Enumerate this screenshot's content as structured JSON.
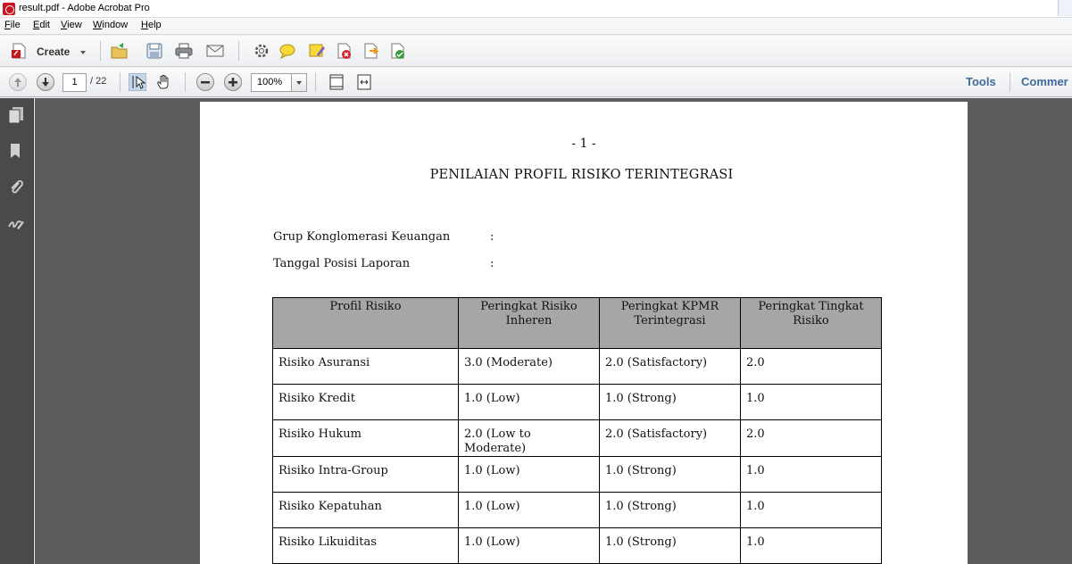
{
  "window": {
    "title": "result.pdf - Adobe Acrobat Pro"
  },
  "menu": {
    "items": [
      {
        "pre": "",
        "u": "F",
        "post": "ile"
      },
      {
        "pre": "",
        "u": "E",
        "post": "dit"
      },
      {
        "pre": "",
        "u": "V",
        "post": "iew"
      },
      {
        "pre": "",
        "u": "W",
        "post": "indow"
      },
      {
        "pre": "",
        "u": "H",
        "post": "elp"
      }
    ]
  },
  "toolbar": {
    "create_label": "Create"
  },
  "nav": {
    "current_page": "1",
    "total_pages": "/ 22",
    "zoom": "100%"
  },
  "right_tabs": {
    "tools": "Tools",
    "comment": "Commer"
  },
  "document": {
    "page_number": "- 1 -",
    "title": "PENILAIAN PROFIL RISIKO TERINTEGRASI",
    "fields": [
      {
        "label": "Grup Konglomerasi Keuangan",
        "colon": ":"
      },
      {
        "label": "Tanggal Posisi Laporan",
        "colon": ":"
      }
    ],
    "table": {
      "headers": [
        "Profil Risiko",
        "Peringkat Risiko Inheren",
        "Peringkat KPMR Terintegrasi",
        "Peringkat Tingkat Risiko"
      ],
      "rows": [
        [
          "Risiko Asuransi",
          "3.0 (Moderate)",
          "2.0 (Satisfactory)",
          "2.0"
        ],
        [
          "Risiko Kredit",
          "1.0 (Low)",
          "1.0 (Strong)",
          "1.0"
        ],
        [
          "Risiko Hukum",
          "2.0 (Low to Moderate)",
          "2.0 (Satisfactory)",
          "2.0"
        ],
        [
          "Risiko Intra-Group",
          "1.0 (Low)",
          "1.0 (Strong)",
          "1.0"
        ],
        [
          "Risiko Kepatuhan",
          "1.0 (Low)",
          "1.0 (Strong)",
          "1.0"
        ],
        [
          "Risiko Likuiditas",
          "1.0 (Low)",
          "1.0 (Strong)",
          "1.0"
        ]
      ]
    }
  },
  "icons": {
    "toolbar1": [
      "open-icon",
      "save-icon",
      "print-icon",
      "email-icon",
      "settings-icon",
      "comment-icon",
      "sticky-note-icon",
      "sign-icon",
      "share-icon",
      "export-icon"
    ],
    "toolbar2": [
      "page-up-icon",
      "page-down-icon",
      "select-icon",
      "hand-icon",
      "zoom-out-icon",
      "zoom-in-icon",
      "fit-page-icon",
      "fit-width-icon"
    ],
    "leftnav": [
      "pages-icon",
      "bookmarks-icon",
      "attachments-icon",
      "signatures-icon"
    ]
  }
}
